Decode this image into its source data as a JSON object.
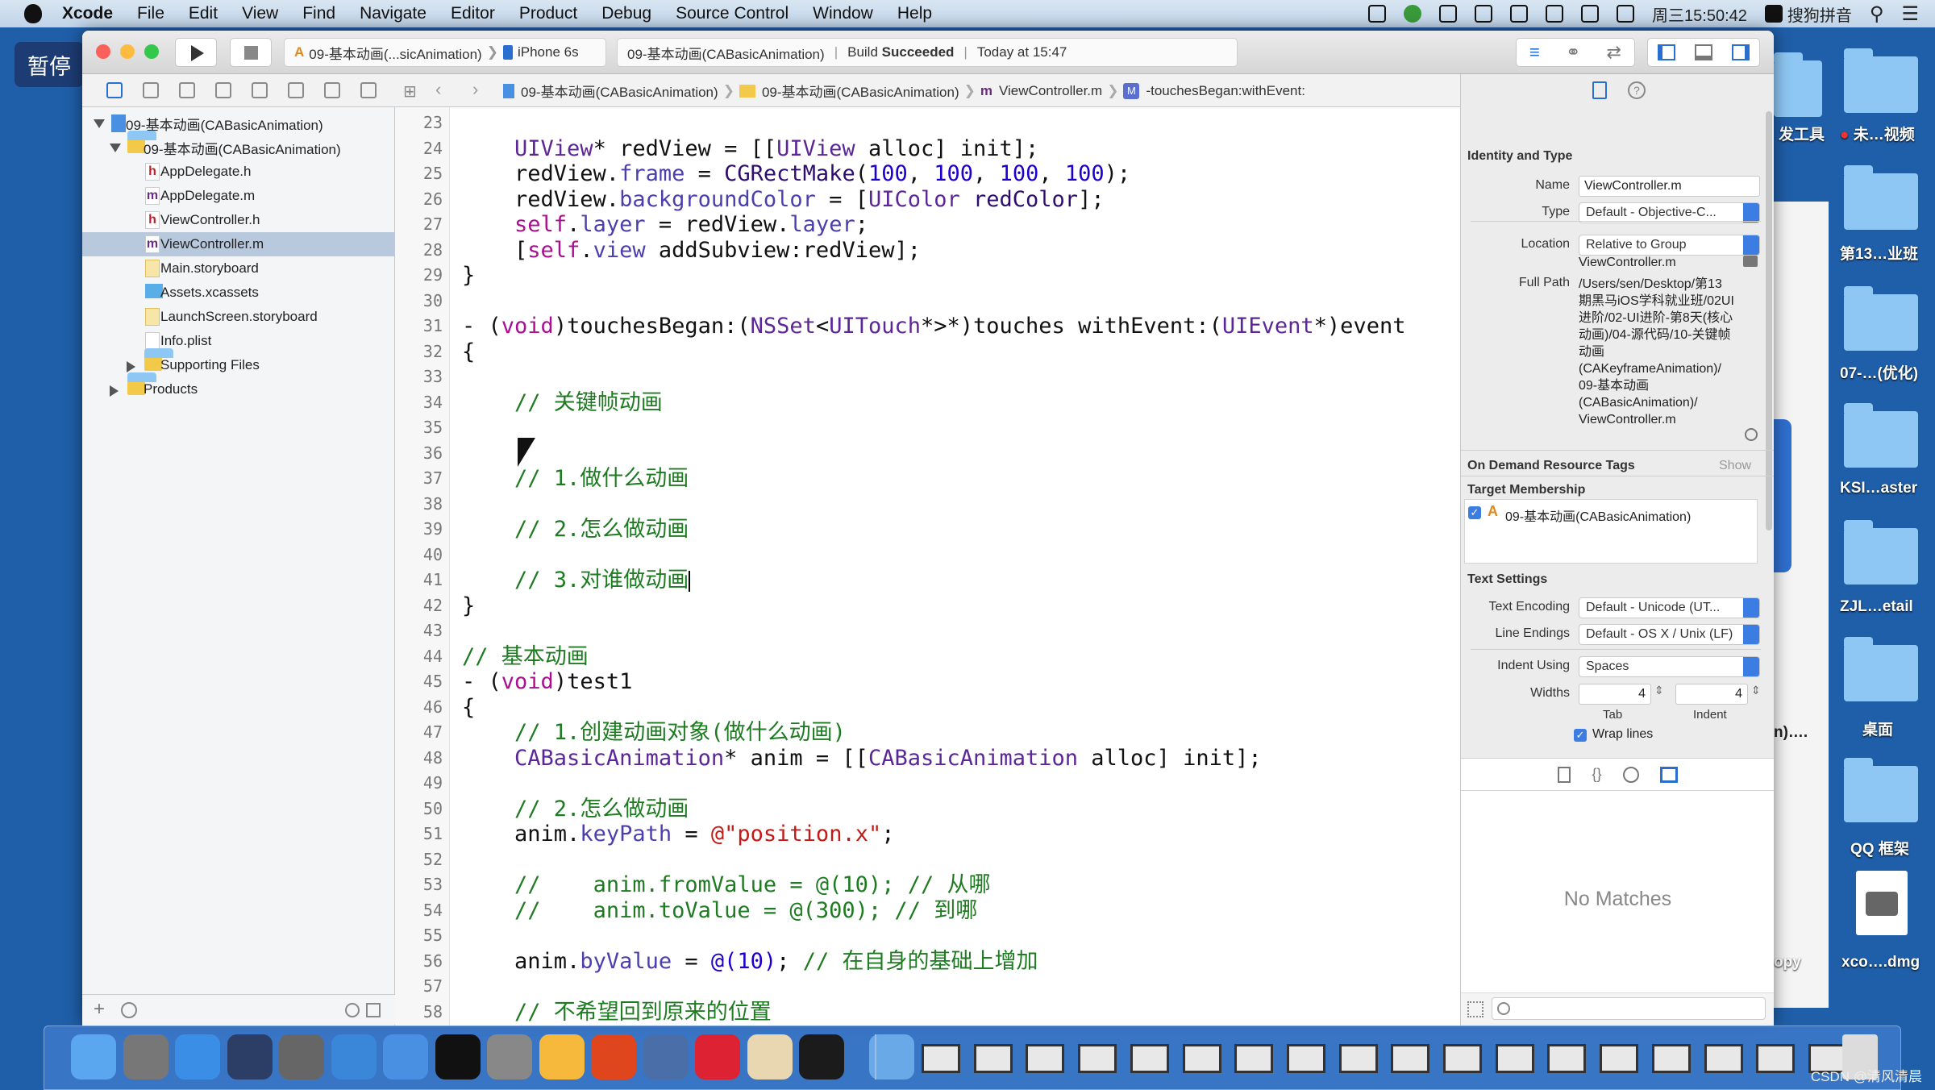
{
  "menubar": {
    "app": "Xcode",
    "items": [
      "File",
      "Edit",
      "View",
      "Find",
      "Navigate",
      "Editor",
      "Product",
      "Debug",
      "Source Control",
      "Window",
      "Help"
    ],
    "clock": "周三15:50:42",
    "ime": "搜狗拼音",
    "status_icons": [
      "screen-share-icon",
      "play-circle-icon",
      "camera-icon",
      "plus-icon",
      "bluetooth-icon",
      "lock-icon",
      "wifi-icon",
      "volume-icon"
    ]
  },
  "pause_badge": "暂停",
  "toolbar": {
    "scheme": "09-基本动画(...sicAnimation)",
    "device": "iPhone 6s",
    "status_project": "09-基本动画(CABasicAnimation)",
    "build_label": "Build",
    "build_status": "Succeeded",
    "time": "Today at 15:47"
  },
  "jumpbar": [
    "09-基本动画(CABasicAnimation)",
    "09-基本动画(CABasicAnimation)",
    "ViewController.m",
    "-touchesBegan:withEvent:"
  ],
  "navigator": {
    "items": [
      {
        "label": "09-基本动画(CABasicAnimation)",
        "icon": "project-icon",
        "level": 0,
        "disc": "open"
      },
      {
        "label": "09-基本动画(CABasicAnimation)",
        "icon": "folder-icon",
        "level": 1,
        "disc": "open"
      },
      {
        "label": "AppDelegate.h",
        "icon": "header-file-icon",
        "level": 2
      },
      {
        "label": "AppDelegate.m",
        "icon": "implementation-file-icon",
        "level": 2
      },
      {
        "label": "ViewController.h",
        "icon": "header-file-icon",
        "level": 2
      },
      {
        "label": "ViewController.m",
        "icon": "implementation-file-icon",
        "level": 2,
        "selected": true
      },
      {
        "label": "Main.storyboard",
        "icon": "storyboard-icon",
        "level": 2
      },
      {
        "label": "Assets.xcassets",
        "icon": "assets-icon",
        "level": 2
      },
      {
        "label": "LaunchScreen.storyboard",
        "icon": "storyboard-icon",
        "level": 2
      },
      {
        "label": "Info.plist",
        "icon": "plist-icon",
        "level": 2
      },
      {
        "label": "Supporting Files",
        "icon": "folder-icon",
        "level": 2,
        "disc": "closed"
      },
      {
        "label": "Products",
        "icon": "folder-icon",
        "level": 1,
        "disc": "closed"
      }
    ]
  },
  "editor": {
    "lines": [
      {
        "n": "23",
        "t": []
      },
      {
        "n": "24",
        "t": [
          [
            "    ",
            ""
          ],
          [
            "UIView",
            "t"
          ],
          [
            "* redView = [[",
            ""
          ],
          [
            "UIView",
            "t"
          ],
          [
            " alloc] init];",
            ""
          ]
        ]
      },
      {
        "n": "25",
        "t": [
          [
            "    redView.",
            ""
          ],
          [
            "frame",
            "p"
          ],
          [
            " = ",
            ""
          ],
          [
            "CGRectMake",
            "f"
          ],
          [
            "(",
            ""
          ],
          [
            "100",
            "n"
          ],
          [
            ", ",
            ""
          ],
          [
            "100",
            "n"
          ],
          [
            ", ",
            ""
          ],
          [
            "100",
            "n"
          ],
          [
            ", ",
            ""
          ],
          [
            "100",
            "n"
          ],
          [
            ");",
            ""
          ]
        ]
      },
      {
        "n": "26",
        "t": [
          [
            "    redView.",
            ""
          ],
          [
            "backgroundColor",
            "p"
          ],
          [
            " = [",
            ""
          ],
          [
            "UIColor",
            "t"
          ],
          [
            " ",
            ""
          ],
          [
            "redColor",
            "f"
          ],
          [
            "];",
            ""
          ]
        ]
      },
      {
        "n": "27",
        "t": [
          [
            "    ",
            ""
          ],
          [
            "self",
            "k"
          ],
          [
            ".",
            ""
          ],
          [
            "layer",
            "p"
          ],
          [
            " = redView.",
            ""
          ],
          [
            "layer",
            "p"
          ],
          [
            ";",
            ""
          ]
        ]
      },
      {
        "n": "28",
        "t": [
          [
            "    [",
            ""
          ],
          [
            "self",
            "k"
          ],
          [
            ".",
            ""
          ],
          [
            "view",
            "p"
          ],
          [
            " addSubview:redView];",
            ""
          ]
        ]
      },
      {
        "n": "29",
        "t": [
          [
            "}",
            ""
          ]
        ]
      },
      {
        "n": "30",
        "t": []
      },
      {
        "n": "31",
        "t": [
          [
            "- (",
            ""
          ],
          [
            "void",
            "k"
          ],
          [
            ")touchesBegan:(",
            ""
          ],
          [
            "NSSet",
            "t"
          ],
          [
            "<",
            ""
          ],
          [
            "UITouch",
            "t"
          ],
          [
            "*>*)touches withEvent:(",
            ""
          ],
          [
            "UIEvent",
            "t"
          ],
          [
            "*)event",
            ""
          ]
        ]
      },
      {
        "n": "32",
        "t": [
          [
            "{",
            ""
          ]
        ]
      },
      {
        "n": "33",
        "t": []
      },
      {
        "n": "34",
        "t": [
          [
            "    ",
            ""
          ],
          [
            "// 关键帧动画",
            "c"
          ]
        ]
      },
      {
        "n": "35",
        "t": []
      },
      {
        "n": "36",
        "t": []
      },
      {
        "n": "37",
        "t": [
          [
            "    ",
            ""
          ],
          [
            "// 1.做什么动画",
            "c"
          ]
        ]
      },
      {
        "n": "38",
        "t": []
      },
      {
        "n": "39",
        "t": [
          [
            "    ",
            ""
          ],
          [
            "// 2.怎么做动画",
            "c"
          ]
        ]
      },
      {
        "n": "40",
        "t": []
      },
      {
        "n": "41",
        "t": [
          [
            "    ",
            ""
          ],
          [
            "// 3.对谁做动画",
            "c"
          ]
        ],
        "caret": true
      },
      {
        "n": "42",
        "t": [
          [
            "}",
            ""
          ]
        ]
      },
      {
        "n": "43",
        "t": []
      },
      {
        "n": "44",
        "t": [
          [
            "// 基本动画",
            "c"
          ]
        ]
      },
      {
        "n": "45",
        "t": [
          [
            "- (",
            ""
          ],
          [
            "void",
            "k"
          ],
          [
            ")test1",
            ""
          ]
        ]
      },
      {
        "n": "46",
        "t": [
          [
            "{",
            ""
          ]
        ]
      },
      {
        "n": "47",
        "t": [
          [
            "    ",
            ""
          ],
          [
            "// 1.创建动画对象(做什么动画)",
            "c"
          ]
        ]
      },
      {
        "n": "48",
        "t": [
          [
            "    ",
            ""
          ],
          [
            "CABasicAnimation",
            "t"
          ],
          [
            "* anim = [[",
            ""
          ],
          [
            "CABasicAnimation",
            "t"
          ],
          [
            " alloc] init];",
            ""
          ]
        ]
      },
      {
        "n": "49",
        "t": []
      },
      {
        "n": "50",
        "t": [
          [
            "    ",
            ""
          ],
          [
            "// 2.怎么做动画",
            "c"
          ]
        ]
      },
      {
        "n": "51",
        "t": [
          [
            "    anim.",
            ""
          ],
          [
            "keyPath",
            "p"
          ],
          [
            " = ",
            ""
          ],
          [
            "@\"position.x\"",
            "s"
          ],
          [
            ";",
            ""
          ]
        ]
      },
      {
        "n": "52",
        "t": []
      },
      {
        "n": "53",
        "t": [
          [
            "    ",
            ""
          ],
          [
            "//    anim.fromValue = @(10); // 从哪",
            "c"
          ]
        ]
      },
      {
        "n": "54",
        "t": [
          [
            "    ",
            ""
          ],
          [
            "//    anim.toValue = @(300); // 到哪",
            "c"
          ]
        ]
      },
      {
        "n": "55",
        "t": []
      },
      {
        "n": "56",
        "t": [
          [
            "    anim.",
            ""
          ],
          [
            "byValue",
            "p"
          ],
          [
            " = ",
            ""
          ],
          [
            "@(10)",
            "n"
          ],
          [
            "; ",
            ""
          ],
          [
            "// 在自身的基础上增加",
            "c"
          ]
        ]
      },
      {
        "n": "57",
        "t": []
      },
      {
        "n": "58",
        "t": [
          [
            "    ",
            ""
          ],
          [
            "// 不希望回到原来的位置",
            "c"
          ]
        ]
      }
    ]
  },
  "inspector": {
    "identity": {
      "title": "Identity and Type",
      "name_label": "Name",
      "name_value": "ViewController.m",
      "type_label": "Type",
      "type_value": "Default - Objective-C...",
      "location_label": "Location",
      "location_value": "Relative to Group",
      "relative_file": "ViewController.m",
      "fullpath_label": "Full Path",
      "fullpath_lines": [
        "/Users/sen/Desktop/第13",
        "期黑马iOS学科就业班/02UI",
        "进阶/02-UI进阶-第8天(核心",
        "动画)/04-源代码/10-关键帧",
        "动画",
        "(CAKeyframeAnimation)/",
        "09-基本动画",
        "(CABasicAnimation)/",
        "ViewController.m"
      ]
    },
    "odr": {
      "title": "On Demand Resource Tags",
      "show": "Show"
    },
    "target": {
      "title": "Target Membership",
      "item": "09-基本动画(CABasicAnimation)",
      "checked": true
    },
    "text": {
      "title": "Text Settings",
      "encoding_label": "Text Encoding",
      "encoding_value": "Default - Unicode (UT...",
      "endings_label": "Line Endings",
      "endings_value": "Default - OS X / Unix (LF)",
      "indent_label": "Indent Using",
      "indent_value": "Spaces",
      "widths_label": "Widths",
      "tab_value": "4",
      "indent_value_n": "4",
      "tab_label": "Tab",
      "indent_sub_label": "Indent",
      "wrap_label": "Wrap lines",
      "wrap_checked": true
    },
    "library": {
      "empty": "No Matches"
    }
  },
  "desktop": {
    "labels": [
      "发工具",
      "未…视频",
      "第13…业班",
      "07-…(优化)",
      "KSI…aster",
      "ZJL…etail",
      "n)….",
      "桌面",
      "QQ 框架",
      "opy",
      "xco….dmg"
    ]
  },
  "dock": {
    "apps": [
      {
        "name": "finder-icon",
        "color": "#5aa7f0"
      },
      {
        "name": "launchpad-icon",
        "color": "#777"
      },
      {
        "name": "safari-icon",
        "color": "#3a8ee6"
      },
      {
        "name": "mouse-app-icon",
        "color": "#2c3e66"
      },
      {
        "name": "imovie-icon",
        "color": "#666"
      },
      {
        "name": "xcode-icon",
        "color": "#3a86d8"
      },
      {
        "name": "simulator-icon",
        "color": "#4a90e2"
      },
      {
        "name": "terminal-icon",
        "color": "#111"
      },
      {
        "name": "system-preferences-icon",
        "color": "#888"
      },
      {
        "name": "sketch-icon",
        "color": "#f6b93b"
      },
      {
        "name": "wps-icon",
        "color": "#e0461e"
      },
      {
        "name": "quicktime-icon",
        "color": "#4a6fa8"
      },
      {
        "name": "teamviewer-icon",
        "color": "#d23"
      },
      {
        "name": "notes-icon",
        "color": "#e8d7b0"
      },
      {
        "name": "console-icon",
        "color": "#1b1b1b"
      },
      {
        "name": "media-player-icon",
        "color": "#6aa9e8"
      }
    ],
    "minimized_count": 18
  },
  "watermark": "CSDN @清风清晨"
}
